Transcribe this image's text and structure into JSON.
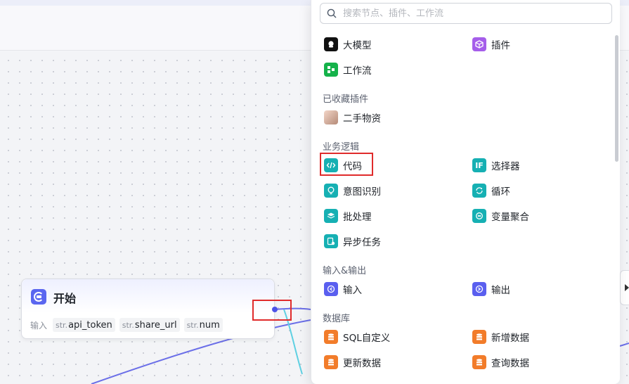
{
  "search": {
    "placeholder": "搜索节点、插件、工作流"
  },
  "top_items": [
    {
      "label": "大模型",
      "icon": "llm-icon"
    },
    {
      "label": "插件",
      "icon": "plugin-cube-icon"
    },
    {
      "label": "工作流",
      "icon": "workflow-icon"
    }
  ],
  "sections": {
    "favorites": {
      "title": "已收藏插件",
      "items": [
        {
          "label": "二手物资",
          "icon": "avatar-icon"
        }
      ]
    },
    "business": {
      "title": "业务逻辑",
      "items": [
        {
          "label": "代码",
          "icon": "code-icon"
        },
        {
          "label": "选择器",
          "icon": "if-icon"
        },
        {
          "label": "意图识别",
          "icon": "bulb-icon"
        },
        {
          "label": "循环",
          "icon": "loop-icon"
        },
        {
          "label": "批处理",
          "icon": "layers-icon"
        },
        {
          "label": "变量聚合",
          "icon": "aggregate-icon"
        },
        {
          "label": "异步任务",
          "icon": "async-task-icon"
        }
      ]
    },
    "io": {
      "title": "输入&输出",
      "items": [
        {
          "label": "输入",
          "icon": "input-icon"
        },
        {
          "label": "输出",
          "icon": "output-icon"
        }
      ]
    },
    "database": {
      "title": "数据库",
      "items": [
        {
          "label": "SQL自定义",
          "icon": "database-icon"
        },
        {
          "label": "新增数据",
          "icon": "database-add-icon"
        },
        {
          "label": "更新数据",
          "icon": "database-update-icon"
        },
        {
          "label": "查询数据",
          "icon": "database-query-icon"
        }
      ]
    }
  },
  "start_node": {
    "title": "开始",
    "input_label": "输入",
    "params": [
      {
        "type": "str.",
        "name": "api_token"
      },
      {
        "type": "str.",
        "name": "share_url"
      },
      {
        "type": "str.",
        "name": "num"
      }
    ]
  },
  "colors": {
    "accent": "#4d53e8",
    "teal": "#16b0b3",
    "highlight": "#e02b2b"
  }
}
